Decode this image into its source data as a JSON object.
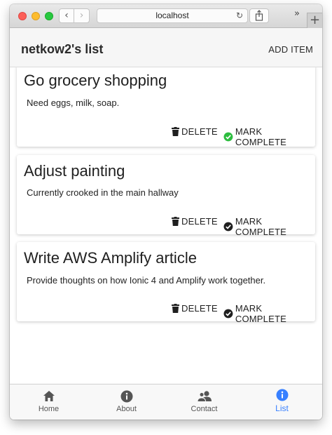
{
  "browser": {
    "url": "localhost",
    "back_icon": "chevron-left-icon",
    "forward_icon": "chevron-right-icon",
    "reload_icon": "reload-icon",
    "share_icon": "share-icon",
    "overflow_icon": "double-chevron-right-icon",
    "new_tab_icon": "plus-icon"
  },
  "header": {
    "title": "netkow2's list",
    "add_item": "ADD ITEM"
  },
  "items": [
    {
      "title": "Go grocery shopping",
      "description": "Need eggs, milk, soap.",
      "delete_label": "DELETE",
      "complete_label": "MARK COMPLETE",
      "completed": true
    },
    {
      "title": "Adjust painting",
      "description": "Currently crooked in the main hallway",
      "delete_label": "DELETE",
      "complete_label": "MARK COMPLETE",
      "completed": false
    },
    {
      "title": "Write AWS Amplify article",
      "description": "Provide thoughts on how Ionic 4 and Amplify work together.",
      "delete_label": "DELETE",
      "complete_label": "MARK COMPLETE",
      "completed": false
    }
  ],
  "tabs": [
    {
      "label": "Home",
      "icon": "home-icon",
      "active": false
    },
    {
      "label": "About",
      "icon": "info-icon",
      "active": false
    },
    {
      "label": "Contact",
      "icon": "contacts-icon",
      "active": false
    },
    {
      "label": "List",
      "icon": "info-icon",
      "active": true
    }
  ],
  "colors": {
    "accent": "#3880ff",
    "complete_green": "#2dbd3f",
    "text": "#1f1f1f"
  }
}
